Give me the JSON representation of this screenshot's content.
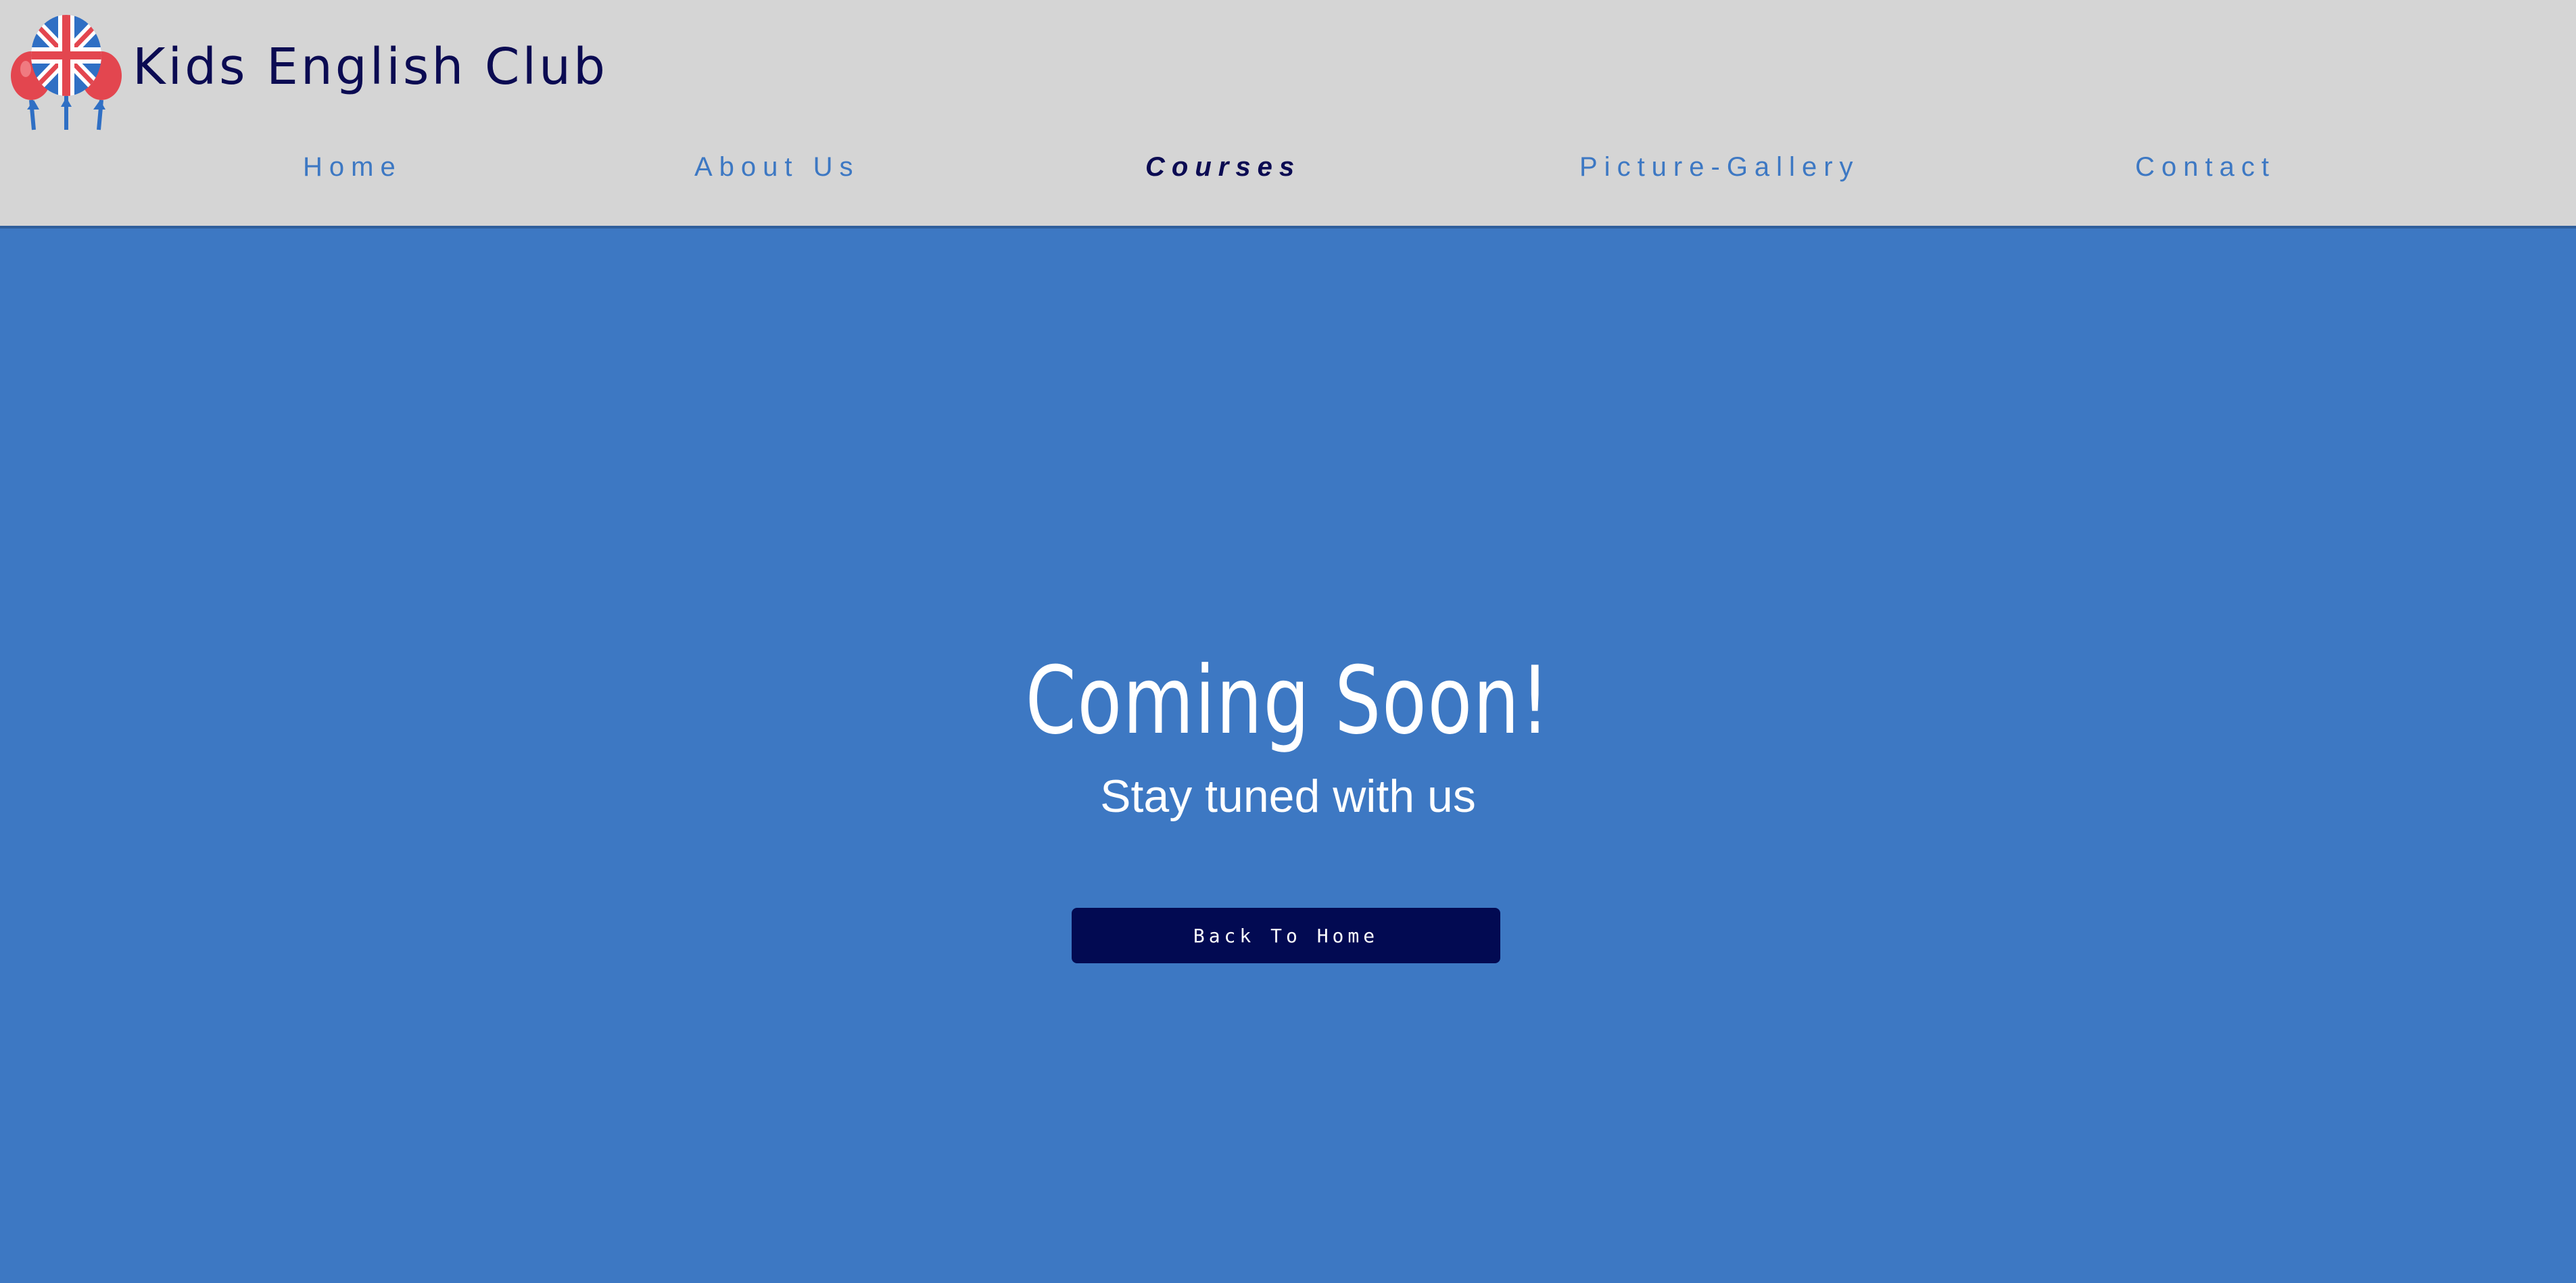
{
  "header": {
    "site_title": "Kids English Club",
    "logo_icon": "union-jack-balloons-logo"
  },
  "nav": {
    "items": [
      {
        "label": "Home",
        "active": false
      },
      {
        "label": "About Us",
        "active": false
      },
      {
        "label": "Courses",
        "active": true
      },
      {
        "label": "Picture-Gallery",
        "active": false
      },
      {
        "label": "Contact",
        "active": false
      }
    ]
  },
  "hero": {
    "title": "Coming Soon!",
    "subtitle": "Stay tuned with us",
    "button_label": "Back To Home"
  },
  "colors": {
    "header_bg": "#d5d5d5",
    "page_bg": "#3d78c3",
    "nav_text": "#3d78c3",
    "nav_active": "#0b0b52",
    "button_bg": "#020a52",
    "balloon_red": "#e3464f"
  }
}
